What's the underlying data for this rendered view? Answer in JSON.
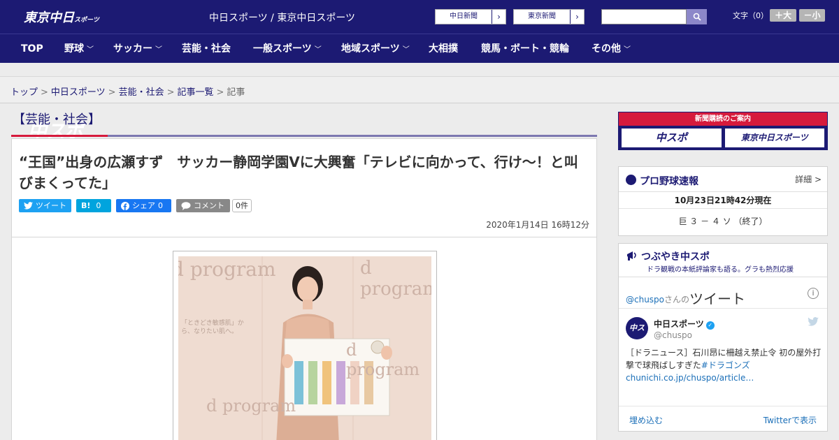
{
  "header": {
    "logo_main": "中スポ",
    "logo_sub": "東京中日",
    "logo_sub_small": "スポーツ",
    "title": "中日スポーツ / 東京中日スポーツ",
    "paper_links": [
      "中日新聞",
      "東京新聞"
    ],
    "search_placeholder": "",
    "font_size_label": "文字（0）",
    "font_larger": "＋大",
    "font_smaller": "－小"
  },
  "nav": {
    "items": [
      {
        "label": "TOP",
        "dropdown": false
      },
      {
        "label": "野球",
        "dropdown": true
      },
      {
        "label": "サッカー",
        "dropdown": true
      },
      {
        "label": "芸能・社会",
        "dropdown": false
      },
      {
        "label": "一般スポーツ",
        "dropdown": true
      },
      {
        "label": "地域スポーツ",
        "dropdown": true
      },
      {
        "label": "大相撲",
        "dropdown": false
      },
      {
        "label": "競馬・ボート・競輪",
        "dropdown": false
      },
      {
        "label": "その他",
        "dropdown": true
      }
    ]
  },
  "breadcrumb": {
    "items": [
      "トップ",
      "中日スポーツ",
      "芸能・社会",
      "記事一覧"
    ],
    "current": "記事",
    "separator": ">"
  },
  "article": {
    "category": "【芸能・社会】",
    "headline": "“王国”出身の広瀬すず　サッカー静岡学園Vに大興奮「テレビに向かって、行け～！と叫びまくってた」",
    "share": {
      "tweet": "ツイート",
      "hatena": "B!",
      "hatena_count": "0",
      "facebook": "シェア",
      "facebook_count": "0",
      "comment": "コメント",
      "comment_count": "0件"
    },
    "date": "2020年1月14日 16時12分",
    "photo_texts": [
      "d program",
      "d program",
      "d program",
      "d program",
      "「ときどき敏感肌」から、なりたい肌へ。"
    ]
  },
  "sidebar": {
    "subscribe": {
      "title": "新聞購読のご案内",
      "logos": [
        "中スポ",
        "東京中日スポーツ"
      ]
    },
    "baseball": {
      "title": "プロ野球速報",
      "detail": "詳細 >",
      "time": "10月23日21時42分現在",
      "score": "巨 ３ － ４ ソ （終了）"
    },
    "twitter": {
      "title": "つぶやき中スポ",
      "subtitle": "ドラ観戦の本紙評論家も語る。グラも熱烈応援",
      "handle_prefix": "@chuspo",
      "handle_suffix": "さんの",
      "widget_title": "ツイート",
      "name": "中日スポーツ",
      "at": "@chuspo",
      "tweet_text": "［ドラニュース］石川昂に柵越え禁止令 初の屋外打撃で球飛ばしすぎた",
      "tweet_hashtag": "#ドラゴンズ",
      "tweet_link": "chunichi.co.jp/chuspo/article…",
      "embed": "埋め込む",
      "view_on": "Twitterで表示"
    }
  },
  "colors": {
    "brand_navy": "#1c1a73",
    "accent_red": "#d61a3c",
    "twitter": "#1da1f2",
    "hatena": "#00a4de",
    "facebook": "#1877f2",
    "comment": "#888888"
  }
}
